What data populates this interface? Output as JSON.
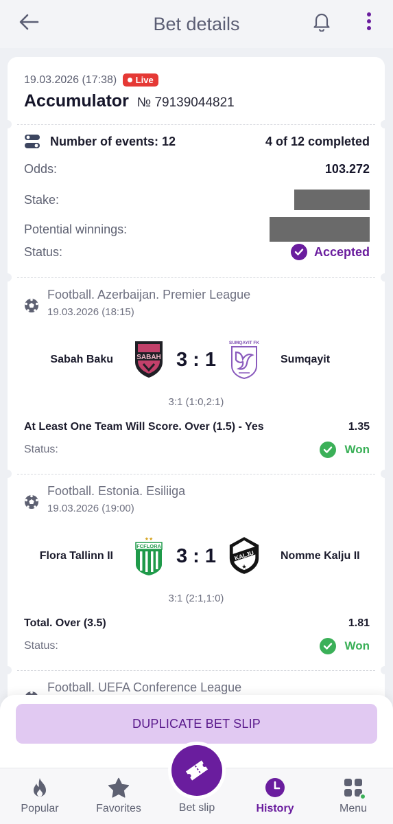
{
  "header": {
    "title": "Bet details"
  },
  "bet": {
    "datetime": "19.03.2026 (17:38)",
    "live_label": "Live",
    "type": "Accumulator",
    "number": "№ 79139044821",
    "events_label": "Number of events: 12",
    "completed": "4 of 12 completed",
    "odds_label": "Odds:",
    "odds_value": "103.272",
    "stake_label": "Stake:",
    "potential_label": "Potential winnings:",
    "status_label": "Status:",
    "status_value": "Accepted"
  },
  "events": [
    {
      "league": "Football. Azerbaijan. Premier League",
      "date": "19.03.2026 (18:15)",
      "home": "Sabah Baku",
      "away": "Sumqayit",
      "home_logo_text": "SABAH",
      "away_logo_text": "SUMQAYIT FK",
      "score": "3 : 1",
      "subscore": "3:1 (1:0,2:1)",
      "market": "At Least One Team Will Score. Over (1.5) - Yes",
      "odd": "1.35",
      "status_label": "Status:",
      "status": "Won"
    },
    {
      "league": "Football. Estonia. Esiliiga",
      "date": "19.03.2026 (19:00)",
      "home": "Flora Tallinn II",
      "away": "Nomme Kalju II",
      "home_logo_text": "FCFLORA",
      "away_logo_text": "KALJU",
      "score": "3 : 1",
      "subscore": "3:1 (2:1,1:0)",
      "market": "Total. Over (3.5)",
      "odd": "1.81",
      "status_label": "Status:",
      "status": "Won"
    },
    {
      "league": "Football. UEFA Conference League"
    }
  ],
  "actions": {
    "duplicate": "DUPLICATE BET SLIP"
  },
  "nav": {
    "popular": "Popular",
    "favorites": "Favorites",
    "betslip": "Bet slip",
    "history": "History",
    "menu": "Menu"
  },
  "colors": {
    "accent": "#6a1d9e",
    "live": "#e53935",
    "won": "#3bb058",
    "duplicate_bg": "#e1c9f2"
  },
  "icons": [
    "back-arrow-icon",
    "bell-icon",
    "more-vert-icon",
    "toggle-list-icon",
    "check-circle-icon",
    "soccer-ball-icon",
    "flame-icon",
    "star-icon",
    "ticket-icon",
    "clock-icon",
    "grid-menu-icon"
  ]
}
